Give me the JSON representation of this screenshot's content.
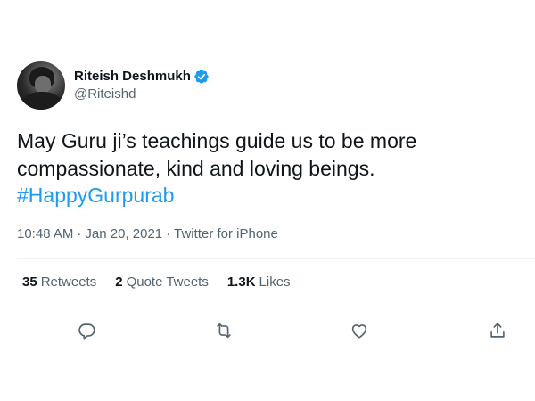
{
  "user": {
    "display_name": "Riteish Deshmukh",
    "handle": "@Riteishd",
    "verified": true,
    "verified_color": "#1d9bf0"
  },
  "tweet": {
    "text_part1": "May Guru ji’s teachings guide us to be more compassionate, kind and loving beings.",
    "hashtag": "#HappyGurpurab",
    "hashtag_color": "#1d9bf0"
  },
  "meta": {
    "time": "10:48 AM",
    "date": "Jan 20, 2021",
    "separator": "·",
    "source": "Twitter for iPhone"
  },
  "stats": {
    "retweets": {
      "count": "35",
      "label": "Retweets"
    },
    "quotes": {
      "count": "2",
      "label": "Quote Tweets"
    },
    "likes": {
      "count": "1.3K",
      "label": "Likes"
    }
  },
  "actions": {
    "reply_icon": "reply-icon",
    "retweet_icon": "retweet-icon",
    "like_icon": "heart-icon",
    "share_icon": "share-icon",
    "icon_color": "#536471"
  }
}
